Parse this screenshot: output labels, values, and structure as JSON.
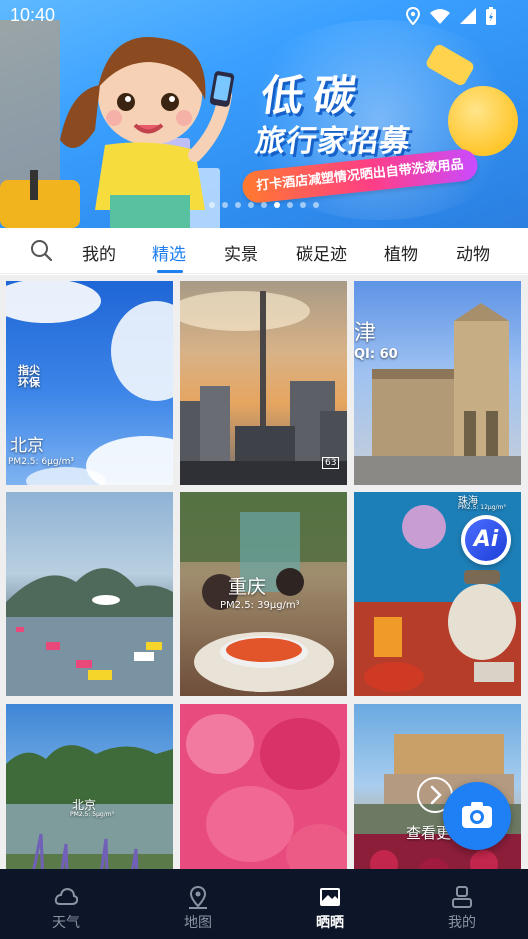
{
  "status_bar": {
    "time": "10:40",
    "icons": [
      "location-icon",
      "wifi-icon",
      "signal-icon",
      "battery-icon"
    ]
  },
  "banner": {
    "headline": "低碳",
    "subheadline": "旅行家招募",
    "tagline": "打卡酒店减塑情况晒出自带洗漱用品",
    "page_count": 9,
    "active_page": 5
  },
  "tabs": {
    "items": [
      {
        "label": "我的"
      },
      {
        "label": "精选"
      },
      {
        "label": "实景"
      },
      {
        "label": "碳足迹"
      },
      {
        "label": "植物"
      },
      {
        "label": "动物"
      }
    ],
    "active_index": 1
  },
  "tiles": [
    {
      "city": "北京",
      "pm": "PM2.5: 6μg/m³",
      "brand": "指尖\n环保"
    },
    {
      "city": "",
      "pm": "",
      "stamp": "63"
    },
    {
      "city": "津",
      "pm": "QI: 60"
    },
    {
      "city": "",
      "pm": ""
    },
    {
      "city": "重庆",
      "pm": "PM2.5: 39μg/m³"
    },
    {
      "city": "珠海",
      "pm": "PM2.5: 12μg/m³"
    },
    {
      "city": "北京",
      "pm": "PM2.5: 5μg/m³"
    },
    {
      "city": "",
      "pm": ""
    },
    {
      "city": "",
      "pm": "",
      "overlay_text": "查看更"
    }
  ],
  "ai_button": {
    "label": "Ai"
  },
  "bottom_nav": {
    "items": [
      {
        "label": "天气",
        "icon": "cloud-icon"
      },
      {
        "label": "地图",
        "icon": "map-pin-icon"
      },
      {
        "label": "晒晒",
        "icon": "photo-icon"
      },
      {
        "label": "我的",
        "icon": "user-icon"
      }
    ],
    "active_index": 2
  },
  "colors": {
    "accent": "#1e7ff0",
    "nav_bg": "#0d1628",
    "fab": "#1f7ff5"
  }
}
